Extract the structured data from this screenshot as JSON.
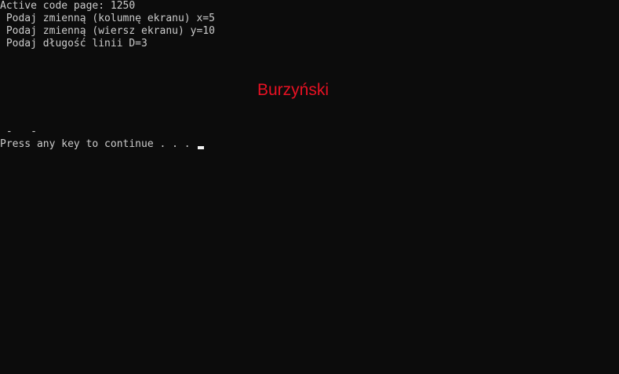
{
  "console": {
    "lines": [
      "Active code page: 1250",
      " Podaj zmienną (kolumnę ekranu) x=5",
      " Podaj zmienną (wiersz ekranu) y=10",
      " Podaj długość linii D=3"
    ],
    "red_text": "Burzyński",
    "dashes_line": " -   -",
    "prompt": "Press any key to continue . . . "
  },
  "colors": {
    "background": "#0c0c0c",
    "foreground": "#cccccc",
    "accent_red": "#e81123"
  }
}
